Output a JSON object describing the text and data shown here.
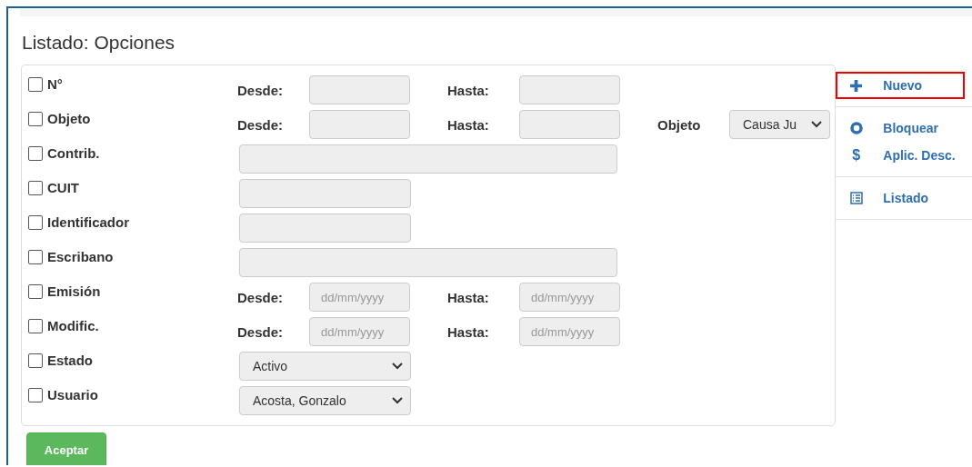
{
  "title": "Listado: Opciones",
  "filters": [
    {
      "kind": "range",
      "label": "N°",
      "checked": false,
      "from_label": "Desde:",
      "to_label": "Hasta:"
    },
    {
      "kind": "range",
      "label": "Objeto",
      "checked": false,
      "from_label": "Desde:",
      "to_label": "Hasta:",
      "extra": {
        "label": "Objeto",
        "value": "Causa Ju"
      }
    },
    {
      "kind": "wide_text",
      "label": "Contrib.",
      "checked": false
    },
    {
      "kind": "text",
      "label": "CUIT",
      "checked": false
    },
    {
      "kind": "text",
      "label": "Identificador",
      "checked": false
    },
    {
      "kind": "wide_text",
      "label": "Escribano",
      "checked": false
    },
    {
      "kind": "range",
      "label": "Emisión",
      "checked": false,
      "from_label": "Desde:",
      "to_label": "Hasta:",
      "from_placeholder": "dd/mm/yyyy",
      "to_placeholder": "dd/mm/yyyy"
    },
    {
      "kind": "range",
      "label": "Modific.",
      "checked": false,
      "from_label": "Desde:",
      "to_label": "Hasta:",
      "from_placeholder": "dd/mm/yyyy",
      "to_placeholder": "dd/mm/yyyy"
    },
    {
      "kind": "select",
      "label": "Estado",
      "checked": false,
      "value": "Activo"
    },
    {
      "kind": "select",
      "label": "Usuario",
      "checked": false,
      "value": "Acosta, Gonzalo"
    }
  ],
  "submit": "Aceptar",
  "actions": [
    [
      {
        "label": "Nuevo",
        "kind": "plus",
        "highlighted": true
      }
    ],
    [
      {
        "label": "Bloquear",
        "kind": "ring",
        "highlighted": false
      },
      {
        "label": "Aplic. Desc.",
        "kind": "glyph",
        "glyph": "$",
        "highlighted": false
      }
    ],
    [
      {
        "label": "Listado",
        "kind": "list",
        "highlighted": false
      }
    ]
  ]
}
